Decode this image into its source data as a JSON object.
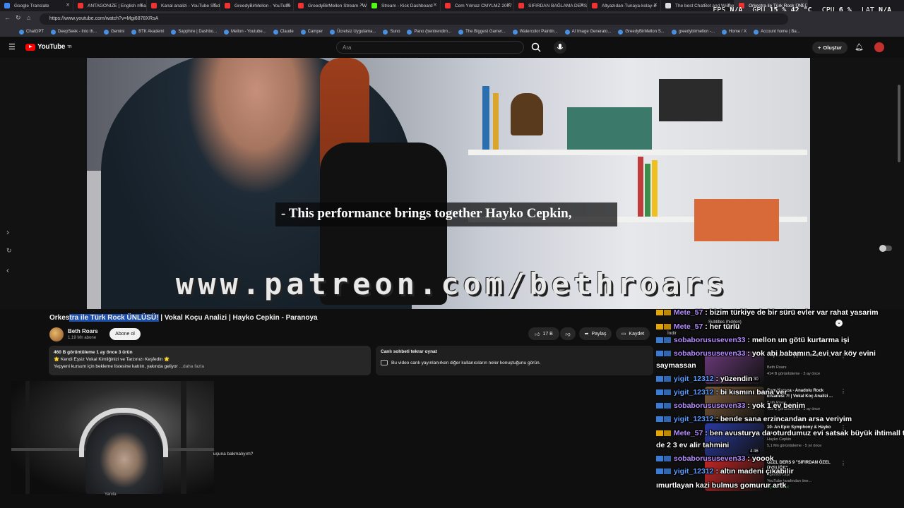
{
  "browser": {
    "tabs": [
      {
        "label": "Google Translate",
        "color": "#4285f4"
      },
      {
        "label": "ANTAGONIZE | English mea",
        "color": "#e33"
      },
      {
        "label": "Kanal analizi - YouTube Studi",
        "color": "#e33"
      },
      {
        "label": "GreedyBirMellon - YouTube",
        "color": "#e33"
      },
      {
        "label": "GreedyBirMellon Stream - W",
        "color": "#e33"
      },
      {
        "label": "Stream - Kick Dashboard",
        "color": "#53fc18"
      },
      {
        "label": "Cem Yılmaz CMYLMZ 2007",
        "color": "#e33"
      },
      {
        "label": "SIFIRDAN BAĞLAMA DERSLE",
        "color": "#e33"
      },
      {
        "label": "Altyazıdan-Tunaya-kolay-e",
        "color": "#e33"
      },
      {
        "label": "The best ChatBot and Widge",
        "color": "#ddd"
      },
      {
        "label": "Orkestra ile Türk Rock ÜNLÜ",
        "color": "#e33"
      }
    ],
    "url": "https://www.youtube.com/watch?v=Mgi6878XRsA",
    "bookmarks": [
      "ChatGPT",
      "DeepSeek - Into th...",
      "Gemini",
      "BTK Akademi",
      "Sapphire | Dashbo...",
      "Mellon - Youtube...",
      "Claude",
      "Camper",
      "Ücretsiz Uygulama...",
      "Suno",
      "Pano (bentrendim...",
      "The Biggest Gamer...",
      "Watercolor Paintin...",
      "AI Image Generato...",
      "GreedyBirMellon S...",
      "greedybirmellon -...",
      "Home / X",
      "Account home | Ba..."
    ]
  },
  "stats": {
    "fps_label": "FPS",
    "fps_value": "N/A",
    "gpu_label": "GPU",
    "gpu_value": "15 % 42 °C",
    "cpu_label": "CPU",
    "cpu_value": "6 %",
    "lat_label": "LAT",
    "lat_value": "N/A"
  },
  "youtube": {
    "logo": "YouTube",
    "logo_country": "TR",
    "search_placeholder": "Ara",
    "create_label": "Oluştur"
  },
  "video": {
    "caption": "- This performance brings together Hayko Cepkin,",
    "watermark": "www.patreon.com/bethroars"
  },
  "meta": {
    "title_pre": "Orkes",
    "title_hl": "tra ile Türk Rock ÜNLÜSÜ!",
    "title_post": " | Vokal Koçu Analizi | Hayko Cepkin - Paranoya",
    "channel": "Beth Roars",
    "subs": "1,19 Mn abone",
    "subscribe": "Abone ol",
    "likes": "17 B",
    "share": "Paylaş",
    "save": "Kaydet"
  },
  "description": {
    "stats": "460 B görüntüleme  1 ay önce  3 ürün",
    "line1": "🌟 Kendi Eşsiz Vokal Kimliğinizi ve Tarzınızı Keşfedin 🌟",
    "line2": "Yepyeni kursum için bekleme listesine katılın, yakında geliyor",
    "more": "...daha fazla"
  },
  "livechat": {
    "title": "Canlı sohbeti tekrar oynat",
    "text": "Bu video canlı yayınlanırken diğer kullanıcıların neler konuştuğunu görün."
  },
  "comments": {
    "below_text": "uşuna bakmalıyım?",
    "sort": "Yanıla"
  },
  "sidebar": {
    "subtitles_hidden": "Subtitles (hidden)",
    "download": "İndir",
    "recs": [
      {
        "title": "Koçu Analizi | Şebnem Ferah -...",
        "channel": "Beth Roars",
        "views": "414 B görüntüleme · 3 ay önce",
        "duration": "8:30",
        "color": "#6b3a7a"
      },
      {
        "title": "Cem Karaca - Anadolu Rock Efsanesi ?! | Vokal Koç Analizi ...",
        "channel": "Beth Roars",
        "views": "463 B görüntüleme · 3 ay önce",
        "duration": "",
        "color": "#7a5a3a"
      },
      {
        "title": "10- An Epic Symphony & Hayko Cepkin",
        "channel": "Hayko Cepkin",
        "views": "5,1 Mn görüntüleme · 5 yıl önce",
        "duration": "4:46",
        "color": "#2a3aa0"
      },
      {
        "title": "ÖZEL DERS 9 \"SIFIRDAN ÖZEL ÜYELİĞE\"",
        "channel": "Egemen Dişli",
        "views": "YouTube tarafından öne...",
        "duration": "",
        "color": "#c32626",
        "badge": "Üyelere özel"
      }
    ]
  },
  "chat": [
    {
      "user": "Mete_57",
      "msg": "bizim türkiye de bir sürü evler var rahat yasarim",
      "badge": "b1",
      "ucls": "u1"
    },
    {
      "user": "Mete_57",
      "msg": "her türlü",
      "badge": "b1",
      "ucls": "u1"
    },
    {
      "user": "sobaborususeven33",
      "msg": "mellon un götü kurtarma işi",
      "badge": "b2",
      "ucls": "u1"
    },
    {
      "user": "sobaborususeven33",
      "msg": "yok abi babamın 2 evi var köy evini",
      "badge": "b2",
      "ucls": "u1"
    },
    {
      "user": "",
      "msg": "saymassan",
      "badge": "",
      "ucls": ""
    },
    {
      "user": "yigit_12312",
      "msg": "yüzendin",
      "badge": "b2",
      "ucls": "u2"
    },
    {
      "user": "yigit_12312",
      "msg": "bi kısmını bana ver",
      "badge": "b2",
      "ucls": "u2"
    },
    {
      "user": "sobaborususeven33",
      "msg": "yok 1 ev benim",
      "badge": "b2",
      "ucls": "u1"
    },
    {
      "user": "yigit_12312",
      "msg": "bende sana erzincandan arsa veriyim",
      "badge": "b2",
      "ucls": "u2"
    },
    {
      "user": "Mete_57",
      "msg": "ben avusturya da oturdumuz evi satsak büyük ihtimall tr",
      "badge": "b1",
      "ucls": "u1"
    },
    {
      "user": "",
      "msg": "de 2 3 ev alir tahmini",
      "badge": "",
      "ucls": ""
    },
    {
      "user": "sobaborususeven33",
      "msg": "yoook",
      "badge": "b2",
      "ucls": "u1"
    },
    {
      "user": "yigit_12312",
      "msg": "altın madeni çıkabilir",
      "badge": "b2",
      "ucls": "u2"
    },
    {
      "user": "",
      "msg": "ımurtlayan kazi bulmus gomurur artk",
      "badge": "",
      "ucls": ""
    }
  ]
}
